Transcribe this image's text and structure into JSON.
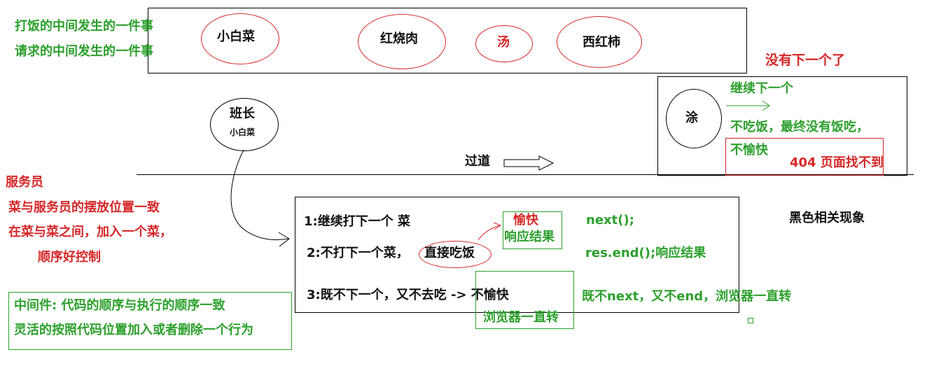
{
  "colors": {
    "green": "#2ca02c",
    "red": "#d62728",
    "black": "#111111"
  },
  "top_left": {
    "line1": "打饭的中间发生的一件事",
    "line2": "请求的中间发生的一件事"
  },
  "dishes": {
    "d1": "小白菜",
    "d2": "红烧肉",
    "d3": "汤",
    "d4": "西红柿"
  },
  "monitor": {
    "title": "班长",
    "sub": "小白菜"
  },
  "aisle_label": "过道",
  "waiter": {
    "title": "服务员",
    "line1": "菜与服务员的摆放位置一致",
    "line2": "在菜与菜之间，加入一个菜，",
    "line3": "顺序好控制"
  },
  "middleware": {
    "line1": "中间件: 代码的顺序与执行的顺序一致",
    "line2": "灵活的按照代码位置加入或者删除一个行为"
  },
  "steps": {
    "s1": "1:继续打下一个 菜",
    "s2a": "2:不打下一个菜，",
    "s2b": "直接吃饭",
    "s3": "3:既不下一个，又不去吃 ->  不愉快",
    "happy": "愉快",
    "respond": "响应结果",
    "spin": "浏览器一直转"
  },
  "code": {
    "next": "next();",
    "end": "res.end();响应结果",
    "neither": "既不next，又不end，浏览器一直转"
  },
  "black_phenomenon": "黑色相关现象",
  "no_next": "没有下一个了",
  "tu_panel": {
    "circle": "涂",
    "continue": "继续下一个",
    "no_eat": "不吃饭，最终没有饭吃，",
    "unhappy": "不愉快",
    "not_found": "404 页面找不到"
  }
}
